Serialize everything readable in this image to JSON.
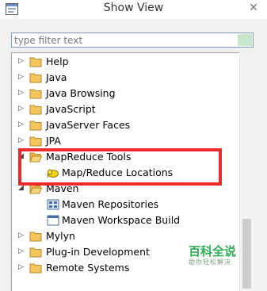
{
  "window": {
    "title": "Show View",
    "close_glyph": "✕"
  },
  "filter": {
    "placeholder": "type filter text",
    "value": ""
  },
  "tree": {
    "items": [
      {
        "label": "Help",
        "expanded": false,
        "icon": "folder-icon"
      },
      {
        "label": "Java",
        "expanded": false,
        "icon": "folder-icon"
      },
      {
        "label": "Java Browsing",
        "expanded": false,
        "icon": "folder-icon"
      },
      {
        "label": "JavaScript",
        "expanded": false,
        "icon": "folder-icon"
      },
      {
        "label": "JavaServer Faces",
        "expanded": false,
        "icon": "folder-icon"
      },
      {
        "label": "JPA",
        "expanded": false,
        "icon": "folder-icon"
      },
      {
        "label": "MapReduce Tools",
        "expanded": true,
        "icon": "folder-open-icon",
        "children": [
          {
            "label": "Map/Reduce Locations",
            "icon": "elephant-icon"
          }
        ]
      },
      {
        "label": "Maven",
        "expanded": true,
        "icon": "folder-open-icon",
        "children": [
          {
            "label": "Maven Repositories",
            "icon": "repository-icon"
          },
          {
            "label": "Maven Workspace Build",
            "icon": "window-icon"
          }
        ]
      },
      {
        "label": "Mylyn",
        "expanded": false,
        "icon": "folder-icon"
      },
      {
        "label": "Plug-in Development",
        "expanded": false,
        "icon": "folder-icon"
      },
      {
        "label": "Remote Systems",
        "expanded": false,
        "icon": "folder-icon"
      }
    ]
  },
  "watermark": {
    "title": "百科全说",
    "subtitle": "助你轻松解决"
  },
  "colors": {
    "highlight": "#ea2c2c",
    "folder": "#e8b84a",
    "watermark": "#2fae56"
  }
}
